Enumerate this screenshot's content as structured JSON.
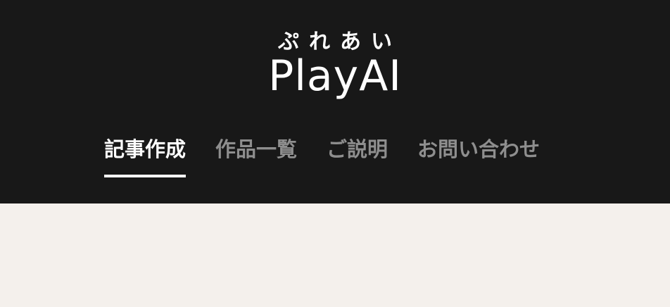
{
  "header": {
    "logo": {
      "kana": "ぷれあい",
      "wordmark": "PlayAI"
    },
    "nav": {
      "items": [
        {
          "label": "記事作成",
          "active": true
        },
        {
          "label": "作品一覧",
          "active": false
        },
        {
          "label": "ご説明",
          "active": false
        },
        {
          "label": "お問い合わせ",
          "active": false
        }
      ]
    }
  },
  "colors": {
    "header_bg": "#181818",
    "page_bg": "#f4f0ec",
    "nav_active": "#ffffff",
    "nav_inactive": "#8e8e8e"
  }
}
